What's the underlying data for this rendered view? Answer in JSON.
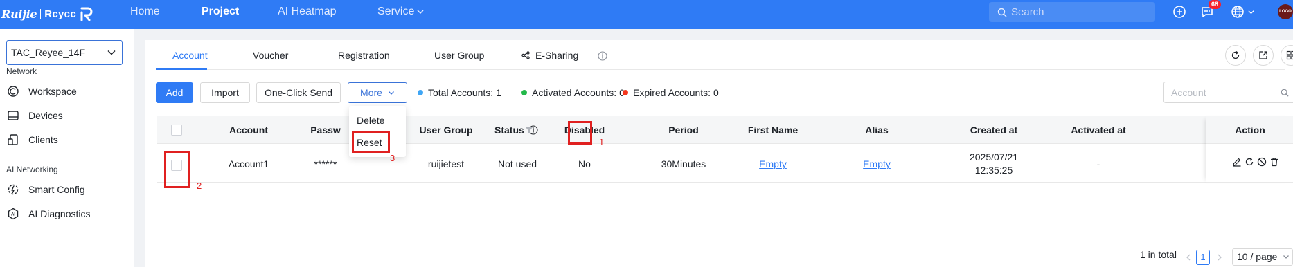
{
  "brand": {
    "name": "Ruijie",
    "product": "Rcycc"
  },
  "topnav": [
    {
      "label": "Home",
      "active": false
    },
    {
      "label": "Project",
      "active": true
    },
    {
      "label": "AI Heatmap",
      "active": false
    },
    {
      "label": "Service",
      "active": false
    }
  ],
  "top_search": {
    "placeholder": "Search"
  },
  "notifications": {
    "count": "68"
  },
  "avatar": {
    "label": "LOGO"
  },
  "sidebar": {
    "site": "TAC_Reyee_14F",
    "sections": [
      {
        "title": "Network",
        "items": [
          {
            "label": "Workspace",
            "icon": "workspace-icon"
          },
          {
            "label": "Devices",
            "icon": "devices-icon"
          },
          {
            "label": "Clients",
            "icon": "clients-icon"
          }
        ]
      },
      {
        "title": "AI Networking",
        "items": [
          {
            "label": "Smart Config",
            "icon": "smart-config-icon"
          },
          {
            "label": "AI Diagnostics",
            "icon": "ai-diagnostics-icon"
          }
        ]
      }
    ]
  },
  "tabs": [
    {
      "label": "Account",
      "active": true
    },
    {
      "label": "Voucher"
    },
    {
      "label": "Registration"
    },
    {
      "label": "User Group"
    },
    {
      "label": "E-Sharing"
    }
  ],
  "toolbar": {
    "add": "Add",
    "import": "Import",
    "one_click_send": "One-Click Send",
    "more": "More",
    "search_placeholder": "Account"
  },
  "stats": {
    "total": "Total Accounts: 1",
    "activated": "Activated Accounts: 0",
    "expired": "Expired Accounts: 0",
    "colors": {
      "total": "#3fa6f5",
      "activated": "#23b94a",
      "expired": "#f5381e"
    }
  },
  "more_menu": [
    "Delete",
    "Reset"
  ],
  "table": {
    "columns": [
      "Account",
      "Passw",
      "User Group",
      "Status",
      "Disabled",
      "Period",
      "First Name",
      "Alias",
      "Created at",
      "Activated at",
      "Action"
    ],
    "rows": [
      {
        "account": "Account1",
        "password": "******",
        "user_group": "ruijietest",
        "status": "Not used",
        "disabled": "No",
        "period": "30Minutes",
        "first_name": "Empty",
        "alias": "Empty",
        "created_date": "2025/07/21",
        "created_time": "12:35:25",
        "activated_at": "-"
      }
    ]
  },
  "annotations": [
    "1",
    "2",
    "3"
  ],
  "pagination": {
    "total": "1 in total",
    "current": "1",
    "page_size": "10 / page"
  }
}
